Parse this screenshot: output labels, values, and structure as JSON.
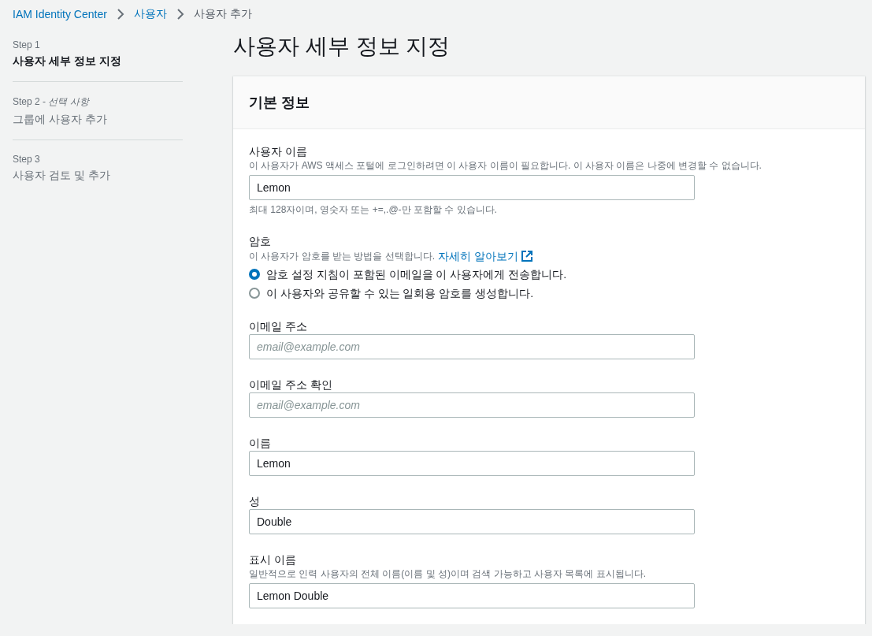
{
  "breadcrumb": [
    {
      "label": "IAM Identity Center",
      "link": true
    },
    {
      "label": "사용자",
      "link": true
    },
    {
      "label": "사용자 추가",
      "link": false
    }
  ],
  "steps": [
    {
      "step": "Step 1",
      "title": "사용자 세부 정보 지정",
      "selected": true
    },
    {
      "step": "Step 2 - *선택 사항*",
      "title": "그룹에 사용자 추가",
      "selected": false
    },
    {
      "step": "Step 3",
      "title": "사용자 검토 및 추가",
      "selected": false
    }
  ],
  "page_title": "사용자 세부 정보 지정",
  "panel": {
    "title": "기본 정보",
    "fields": [
      {
        "kind": "text",
        "label": "사용자 이름",
        "description": "이 사용자가 AWS 액세스 포털에 로그인하려면 이 사용자 이름이 필요합니다. 이 사용자 이름은 나중에 변경할 수 없습니다.",
        "value": "Lemon",
        "constraint": "최대 128자이며, 영숫자 또는 +=,.@-만 포함할 수 있습니다."
      },
      {
        "kind": "radio",
        "label": "암호",
        "description": "이 사용자가 암호를 받는 방법을 선택합니다.",
        "link": "자세히 알아보기",
        "options": [
          {
            "label": "암호 설정 지침이 포함된 이메일을 이 사용자에게 전송합니다.",
            "selected": true
          },
          {
            "label": "이 사용자와 공유할 수 있는 일회용 암호를 생성합니다.",
            "selected": false
          }
        ]
      },
      {
        "kind": "text",
        "label": "이메일 주소",
        "placeholder": "email@example.com"
      },
      {
        "kind": "text",
        "label": "이메일 주소 확인",
        "placeholder": "email@example.com"
      },
      {
        "kind": "text",
        "label": "이름",
        "value": "Lemon"
      },
      {
        "kind": "text",
        "label": "성",
        "value": "Double"
      },
      {
        "kind": "text",
        "label": "표시 이름",
        "description": "일반적으로 인력 사용자의 전체 이름(이름 및 성)이며 검색 가능하고 사용자 목록에 표시됩니다.",
        "value": "Lemon Double"
      }
    ]
  }
}
